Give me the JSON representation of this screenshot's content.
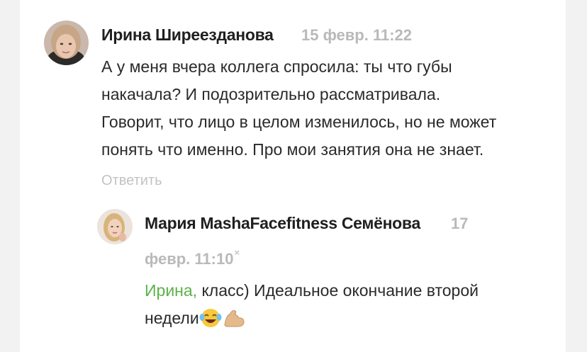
{
  "comment": {
    "author": "Ирина Ширеезданова",
    "date": "15 февр. 11:22",
    "lines": [
      "А у меня вчера коллега спросила: ты что губы",
      "накачала? И подозрительно рассматривала.",
      "Говорит, что лицо в целом изменилось, но не может",
      "понять что именно. Про мои занятия она не знает."
    ],
    "reply_label": "Ответить"
  },
  "reply": {
    "author": "Мария MashaFacefitness Семёнова",
    "date_part1": "17",
    "date_part2": "февр. 11:10",
    "close_mark": "×",
    "mention": "Ирина,",
    "line1": " класс) Идеальное окончание второй",
    "line2": "недели",
    "emojis": [
      "laughing-crying-emoji",
      "flexed-biceps-emoji"
    ]
  },
  "colors": {
    "mention": "#5bb34a",
    "date": "#b9b9b9",
    "reply_link": "#c3c3c3"
  }
}
